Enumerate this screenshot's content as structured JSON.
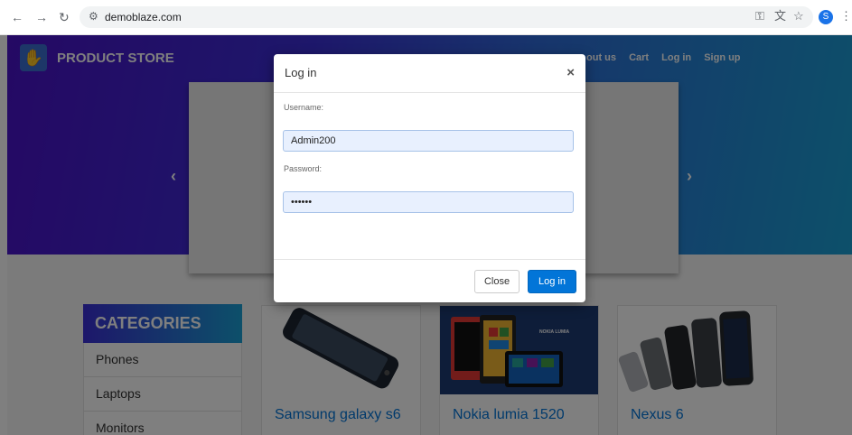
{
  "browser": {
    "url": "demoblaze.com",
    "back_icon": "arrow-left-icon",
    "forward_icon": "arrow-right-icon",
    "reload_icon": "reload-icon",
    "site_info_icon": "tune-icon",
    "profile_initial": "S"
  },
  "header": {
    "brand": "PRODUCT STORE",
    "nav": [
      "out us",
      "Cart",
      "Log in",
      "Sign up"
    ]
  },
  "carousel": {
    "prev": "‹",
    "next": "›"
  },
  "categories": {
    "title": "CATEGORIES",
    "items": [
      "Phones",
      "Laptops",
      "Monitors"
    ]
  },
  "products": [
    {
      "name": "Samsung galaxy s6"
    },
    {
      "name": "Nokia lumia 1520",
      "image_caption": "NOKIA LUMIA"
    },
    {
      "name": "Nexus 6"
    }
  ],
  "modal": {
    "title": "Log in",
    "close_symbol": "×",
    "username_label": "Username:",
    "username_value": "Admin200",
    "password_label": "Password:",
    "password_value": "123456",
    "close_button": "Close",
    "login_button": "Log in"
  },
  "colors": {
    "accent": "#0275d8",
    "hero_start": "#4a12c9",
    "hero_end": "#1aa0d4"
  }
}
